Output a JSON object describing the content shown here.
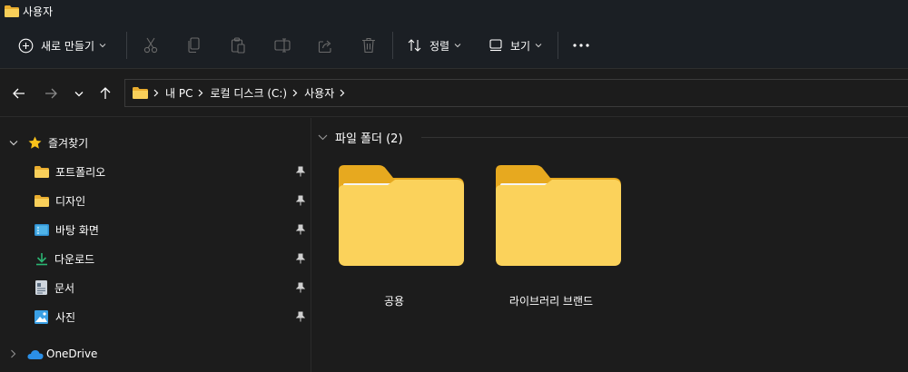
{
  "window": {
    "title": "사용자"
  },
  "toolbar": {
    "new_label": "새로 만들기",
    "sort_label": "정렬",
    "view_label": "보기",
    "more_label": "···"
  },
  "address": {
    "crumbs": [
      "내 PC",
      "로컬 디스크 (C:)",
      "사용자"
    ]
  },
  "sidebar": {
    "quick_access": {
      "label": "즐겨찾기",
      "items": [
        {
          "label": "포트폴리오",
          "icon": "folder-icon"
        },
        {
          "label": "디자인",
          "icon": "folder-icon"
        },
        {
          "label": "바탕 화면",
          "icon": "desktop-icon"
        },
        {
          "label": "다운로드",
          "icon": "download-icon"
        },
        {
          "label": "문서",
          "icon": "document-icon"
        },
        {
          "label": "사진",
          "icon": "pictures-icon"
        }
      ]
    },
    "onedrive": {
      "label": "OneDrive"
    }
  },
  "main": {
    "group_label": "파일 폴더 (2)",
    "folders": [
      {
        "name": "공용"
      },
      {
        "name": "라이브러리 브랜드"
      }
    ]
  },
  "colors": {
    "folder_yellow": "#f6c84a",
    "star": "#f9c21a",
    "onedrive": "#2b8fe6",
    "download": "#2bb673"
  }
}
